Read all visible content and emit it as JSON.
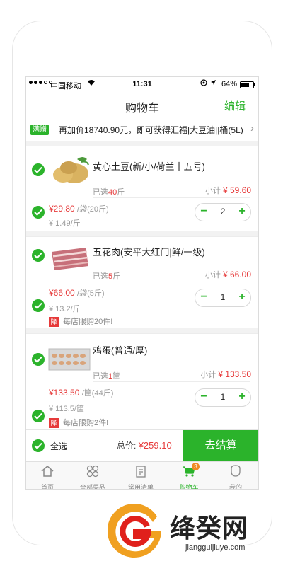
{
  "status": {
    "carrier": "中国移动",
    "time": "11:31",
    "battery": "64%"
  },
  "navbar": {
    "title": "购物车",
    "edit": "编辑"
  },
  "promo": {
    "tag": "满赠",
    "text": "再加价18740.90元，即可获得汇福|大豆油||桶(5L)"
  },
  "items": [
    {
      "name": "黄心土豆(新/小/荷兰十五号)",
      "selected_prefix": "已选",
      "selected_num": "40",
      "selected_unit": "斤",
      "subtotal_label": "小计",
      "subtotal": "¥ 59.60",
      "price": "¥29.80",
      "price_unit": "/袋(20斤)",
      "unit_price": "¥ 1.49/斤",
      "qty": "2"
    },
    {
      "name": "五花肉(安平大红门|鲜/一级)",
      "selected_prefix": "已选",
      "selected_num": "5",
      "selected_unit": "斤",
      "subtotal_label": "小计",
      "subtotal": "¥ 66.00",
      "price": "¥66.00",
      "price_unit": "/袋(5斤)",
      "unit_price": "¥ 13.2/斤",
      "qty": "1",
      "limit_badge": "降",
      "limit_text": "每店限购20件!"
    },
    {
      "name": "鸡蛋(普通/厚)",
      "selected_prefix": "已选",
      "selected_num": "1",
      "selected_unit": "筐",
      "subtotal_label": "小计",
      "subtotal": "¥ 133.50",
      "price": "¥133.50",
      "price_unit": "/筐(44斤)",
      "unit_price": "¥ 113.5/筐",
      "qty": "1",
      "limit_badge": "降",
      "limit_text": "每店限购2件!"
    }
  ],
  "checkout": {
    "select_all": "全选",
    "total_label": "总价:",
    "total": "¥259.10",
    "pay": "去结算"
  },
  "tabs": [
    {
      "label": "首页",
      "icon": "home-icon"
    },
    {
      "label": "全部菜品",
      "icon": "grid-icon"
    },
    {
      "label": "常用清单",
      "icon": "list-icon"
    },
    {
      "label": "购物车",
      "icon": "cart-icon",
      "badge": "3"
    },
    {
      "label": "我的",
      "icon": "user-icon"
    }
  ],
  "watermark": {
    "brand": "绛癸网",
    "url": "jiangguijiuye.com"
  },
  "colors": {
    "accent": "#2bb32b",
    "price": "#e63a3a",
    "badge": "#f08a24"
  }
}
